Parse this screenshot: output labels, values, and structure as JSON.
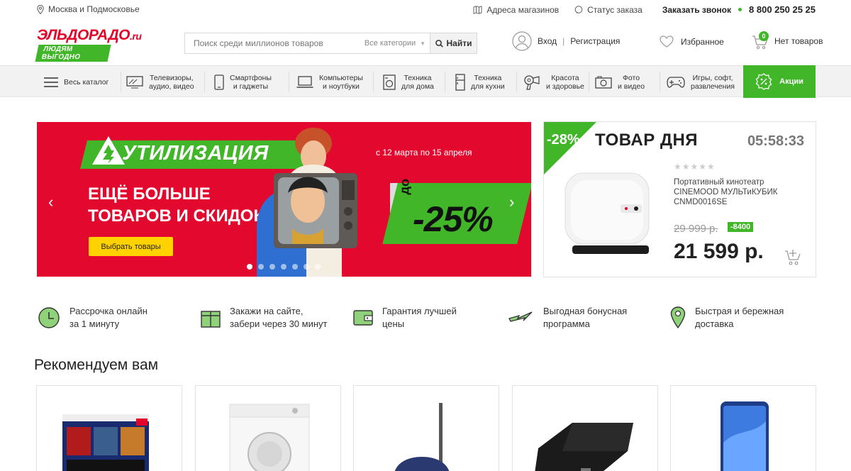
{
  "topbar": {
    "region": "Москва и Подмосковье",
    "stores": "Адреса магазинов",
    "order_status": "Статус заказа",
    "callback": "Заказать звонок",
    "phone": "8 800 250 25 25"
  },
  "header": {
    "logo_main": "ЭЛЬДОРАДО",
    "logo_tld": ".ru",
    "logo_slogan": "ЛЮДЯМ ВЫГОДНО",
    "search_placeholder": "Поиск среди миллионов товаров",
    "search_category": "Все категории",
    "search_button": "Найти",
    "login": "Вход",
    "register": "Регистрация",
    "favorites": "Избранное",
    "cart_count": "0",
    "cart_label": "Нет товаров"
  },
  "catalog": {
    "all": "Весь каталог",
    "items": [
      {
        "label": "Телевизоры,\nаудио, видео",
        "icon": "tv-icon"
      },
      {
        "label": "Смартфоны\nи гаджеты",
        "icon": "smartphone-icon"
      },
      {
        "label": "Компьютеры\nи ноутбуки",
        "icon": "laptop-icon"
      },
      {
        "label": "Техника\nдля дома",
        "icon": "washer-icon"
      },
      {
        "label": "Техника\nдля кухни",
        "icon": "fridge-icon"
      },
      {
        "label": "Красота\nи здоровье",
        "icon": "hairdryer-icon"
      },
      {
        "label": "Фото\nи видео",
        "icon": "camera-icon"
      },
      {
        "label": "Игры, софт,\nразвлечения",
        "icon": "gamepad-icon"
      }
    ],
    "promo": "Акции"
  },
  "banner": {
    "title": "УТИЛИЗАЦИЯ",
    "dates": "с 12 марта по 15 апреля",
    "headline": "ЕЩЁ БОЛЬШЕ\nТОВАРОВ И СКИДОК!",
    "cta": "Выбрать товары",
    "discount_prefix": "до",
    "discount": "-25%",
    "slides_total": 7,
    "slide_active": 1
  },
  "deal": {
    "discount": "-28%",
    "title": "ТОВАР ДНЯ",
    "timer": "05:58:33",
    "rating": 0,
    "product_name": "Портативный кинотеатр CINEMOOD МУЛЬТиКУБИК CNMD0016SE",
    "old_price": "29 999 р.",
    "saving": "-8400",
    "price": "21 599 р."
  },
  "benefits": [
    {
      "text": "Рассрочка онлайн\nза 1 минуту",
      "icon": "clock-icon"
    },
    {
      "text": "Закажи на сайте,\nзабери через 30 минут",
      "icon": "gift-box-icon"
    },
    {
      "text": "Гарантия лучшей\nцены",
      "icon": "wallet-icon"
    },
    {
      "text": "Выгодная бонусная\nпрограмма",
      "icon": "lightning-icon"
    },
    {
      "text": "Быстрая и бережная\nдоставка",
      "icon": "location-pin-icon"
    }
  ],
  "recommended": {
    "title": "Рекомендуем вам",
    "products": [
      {
        "icon": "ps4-bundle-image"
      },
      {
        "icon": "washing-machine-image"
      },
      {
        "icon": "vacuum-cleaner-image"
      },
      {
        "icon": "tv-receiver-image"
      },
      {
        "icon": "smartphone-image"
      }
    ]
  },
  "colors": {
    "brand_red": "#e3042a",
    "brand_green": "#40b628",
    "cta_yellow": "#ffd200"
  }
}
